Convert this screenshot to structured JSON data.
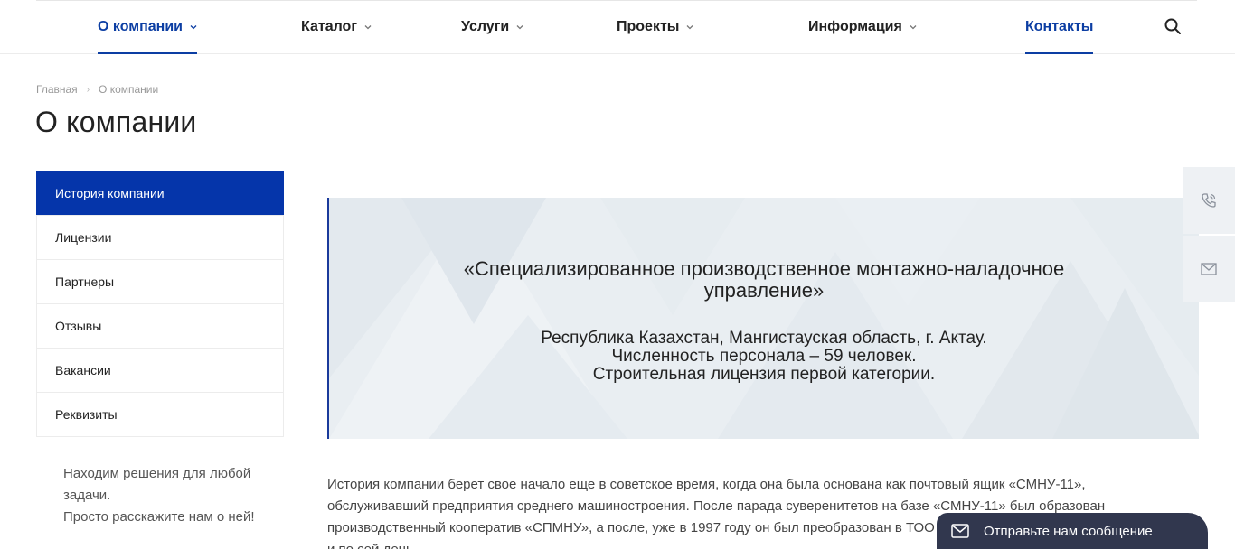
{
  "nav": {
    "items": [
      {
        "label": "О компании",
        "has_dropdown": true,
        "active": true
      },
      {
        "label": "Каталог",
        "has_dropdown": true,
        "active": false
      },
      {
        "label": "Услуги",
        "has_dropdown": true,
        "active": false
      },
      {
        "label": "Проекты",
        "has_dropdown": true,
        "active": false
      },
      {
        "label": "Информация",
        "has_dropdown": true,
        "active": false
      },
      {
        "label": "Контакты",
        "has_dropdown": false,
        "active": true
      }
    ],
    "search_icon": "search-icon",
    "accent_color": "#0c3ea3"
  },
  "breadcrumb": {
    "home": "Главная",
    "separator": "›",
    "current": "О компании"
  },
  "page": {
    "title": "О компании"
  },
  "sidemenu": {
    "items": [
      {
        "label": "История компании",
        "active": true
      },
      {
        "label": "Лицензии",
        "active": false
      },
      {
        "label": "Партнеры",
        "active": false
      },
      {
        "label": "Отзывы",
        "active": false
      },
      {
        "label": "Вакансии",
        "active": false
      },
      {
        "label": "Реквизиты",
        "active": false
      }
    ],
    "active_color": "#0535aa",
    "note_line1": "Находим решения для любой задачи.",
    "note_line2": "Просто расскажите нам о ней!"
  },
  "banner": {
    "title": "«Специализированное производственное монтажно-наладочное управление»",
    "line1": "Республика Казахстан, Мангистауская область, г. Актау.",
    "line2": "Численность персонала – 59 человек.",
    "line3": "Строительная лицензия первой категории."
  },
  "article": {
    "text": "История компании берет свое начало еще в советское время, когда она была основана как почтовый ящик «СМНУ-11», обслуживавший предприятия среднего машиностроения. После парада суверенитетов на базе «СМНУ-11» был образован производственный кооператив «СПМНУ», а после, уже в 1997 году он был преобразован в ТОО «СПМНУ», которое существует и по сей день."
  },
  "float": {
    "phone_icon": "phone-icon",
    "mail_icon": "mail-icon"
  },
  "message_bar": {
    "label": "Отправьте нам сообщение",
    "icon": "mail-icon",
    "bg_color": "#31374e"
  }
}
